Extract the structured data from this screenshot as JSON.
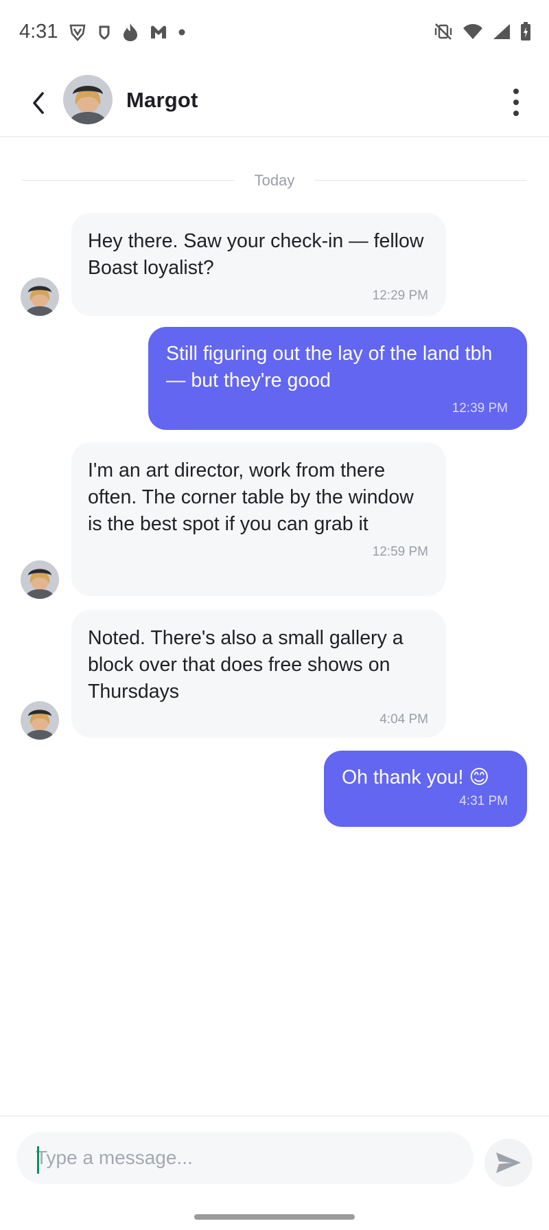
{
  "status_bar": {
    "time": "4:31",
    "left_icons": [
      "vpn-shield-icon",
      "app-badge-icon",
      "flame-icon",
      "app-m-icon",
      "dot-icon"
    ],
    "right_icons": [
      "vibrate-off-icon",
      "wifi-icon",
      "signal-icon",
      "battery-charging-icon"
    ]
  },
  "header": {
    "contact_name": "Margot",
    "back_icon": "chevron-left-icon",
    "menu_icon": "more-vertical-icon"
  },
  "date_separator": "Today",
  "messages": [
    {
      "direction": "incoming",
      "text": "Hey there. Saw your check-in — fellow Boast loyalist?",
      "time": "12:29 PM"
    },
    {
      "direction": "outgoing",
      "text": "Still figuring out the lay of the land tbh — but they're good",
      "time": "12:39 PM"
    },
    {
      "direction": "incoming",
      "text": "I'm an art director, work from there often. The corner table by the window is the best spot if you can grab it",
      "time": "12:59 PM"
    },
    {
      "direction": "incoming",
      "text": "Noted. There's also a small gallery a block over that does free shows on Thursdays",
      "time": "4:04 PM"
    },
    {
      "direction": "outgoing",
      "text": "Oh thank you! 😊",
      "time": "4:31 PM"
    }
  ],
  "composer": {
    "placeholder": "Type a message...",
    "value": "",
    "send_icon": "send-icon"
  },
  "colors": {
    "accent": "#6366f1",
    "incoming_bubble": "#f6f7f9",
    "muted_text": "#9a9ea6"
  }
}
